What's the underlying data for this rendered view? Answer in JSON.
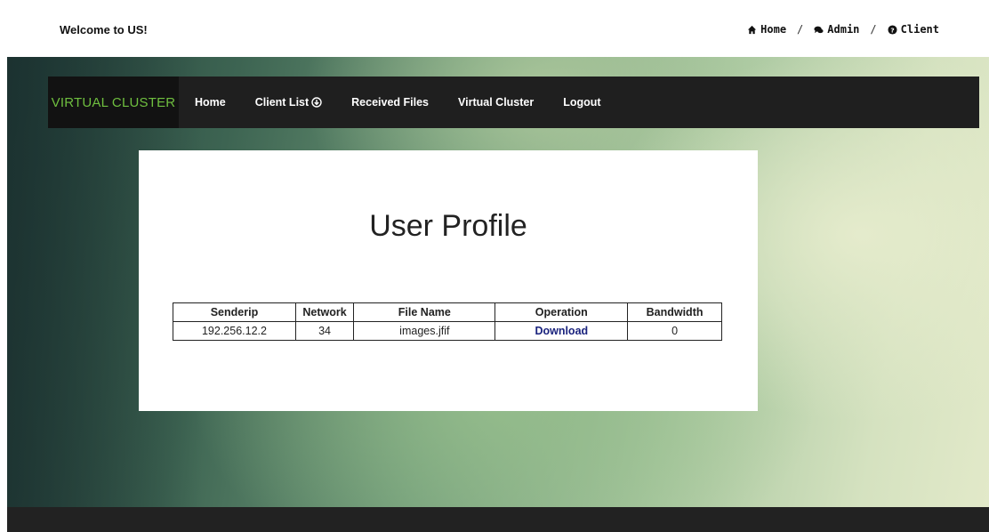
{
  "topbar": {
    "welcome": "Welcome to US!",
    "breadcrumbs": [
      {
        "label": "Home",
        "icon": "home-icon"
      },
      {
        "label": "Admin",
        "icon": "comments-icon"
      },
      {
        "label": "Client",
        "icon": "question-circle-icon"
      }
    ],
    "separator": "/"
  },
  "navbar": {
    "brand": "VIRTUAL CLUSTER",
    "links": [
      {
        "label": "Home"
      },
      {
        "label": "Client List",
        "icon": "circle-caret-down-icon"
      },
      {
        "label": "Received Files"
      },
      {
        "label": "Virtual Cluster"
      },
      {
        "label": "Logout"
      }
    ]
  },
  "panel": {
    "title": "User Profile",
    "table": {
      "headers": [
        "Senderip",
        "Network",
        "File Name",
        "Operation",
        "Bandwidth"
      ],
      "rows": [
        [
          "192.256.12.2",
          "34",
          "images.jfif",
          "Download",
          "0"
        ]
      ]
    }
  },
  "colors": {
    "brand_green": "#6fbf3f",
    "navbar_bg": "#1f1f1f",
    "link_blue": "#1a237e"
  }
}
